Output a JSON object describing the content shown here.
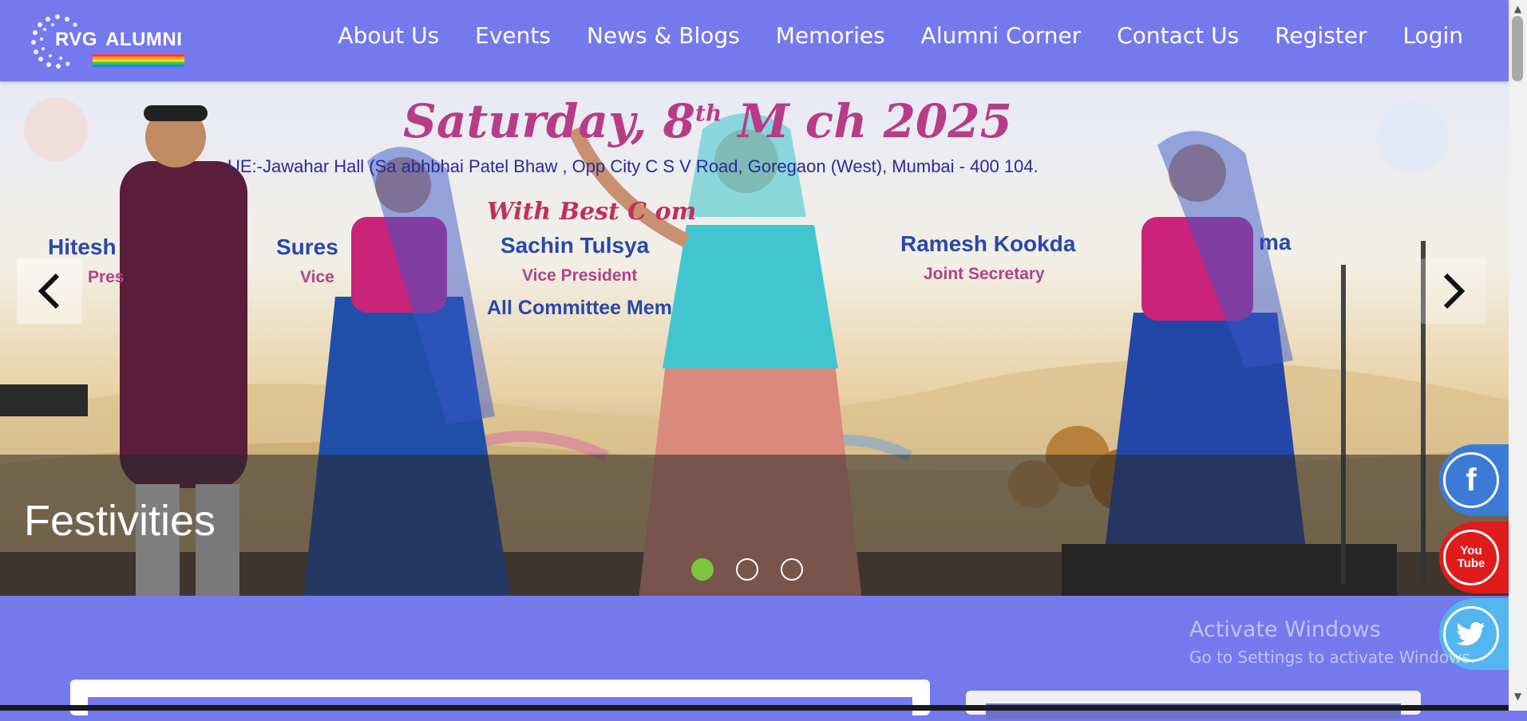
{
  "header": {
    "logo": {
      "text_main": "RVG",
      "text_alt": "ALUMNI"
    },
    "nav": [
      {
        "label": "About Us"
      },
      {
        "label": "Events"
      },
      {
        "label": "News & Blogs"
      },
      {
        "label": "Memories"
      },
      {
        "label": "Alumni Corner"
      },
      {
        "label": "Contact Us"
      },
      {
        "label": "Register"
      },
      {
        "label": "Login"
      }
    ]
  },
  "hero": {
    "caption": "Festivities",
    "banner": {
      "date_pre": "Saturday, 8",
      "date_sup": "th",
      "date_post": " M   ch 2025",
      "venue": "UE:-Jawahar Hall (Sa           abhbhai Patel Bhaw    , Opp City C          S V Road, Goregaon (West), Mumbai - 400 104.",
      "wish": "With Best C                om",
      "people": [
        {
          "name": "Hitesh",
          "role": "Pres"
        },
        {
          "name": "Sures",
          "role": "Vice"
        },
        {
          "name": "Sachin Tulsya",
          "role": "Vice President"
        },
        {
          "name": "Ramesh Kookda",
          "role": "Joint Secretary"
        },
        {
          "name": "ma",
          "role": ""
        }
      ],
      "committee": "All Committee Mem"
    },
    "slides_total": 3,
    "active_slide": 1,
    "colors": {
      "active_dot": "#7cc63f"
    }
  },
  "social": [
    {
      "name": "facebook",
      "glyph": "f"
    },
    {
      "name": "youtube",
      "glyph": "You Tube"
    },
    {
      "name": "twitter",
      "glyph": "twitter-bird"
    }
  ],
  "watermark": {
    "line1": "Activate Windows",
    "line2": "Go to Settings to activate Windows."
  },
  "colors": {
    "brand": "#7579ee",
    "facebook": "#3b7bd6",
    "youtube": "#e01b1b",
    "twitter": "#54b6f0"
  }
}
